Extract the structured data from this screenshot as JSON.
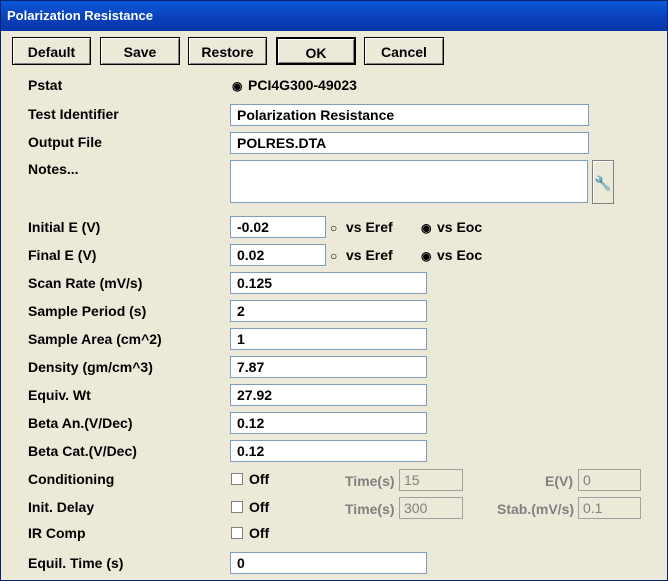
{
  "window": {
    "title": "Polarization Resistance"
  },
  "toolbar": {
    "default_label": "Default",
    "save_label": "Save",
    "restore_label": "Restore",
    "ok_label": "OK",
    "cancel_label": "Cancel"
  },
  "fields": {
    "pstat_label": "Pstat",
    "pstat_value": "PCI4G300-49023",
    "test_identifier_label": "Test Identifier",
    "test_identifier_value": "Polarization Resistance",
    "output_file_label": "Output File",
    "output_file_value": "POLRES.DTA",
    "notes_label": "Notes...",
    "notes_value": "",
    "initial_e_label": "Initial E (V)",
    "initial_e_value": "-0.02",
    "final_e_label": "Final E (V)",
    "final_e_value": "0.02",
    "vs_eref_label": "vs Eref",
    "vs_eoc_label": "vs Eoc",
    "scan_rate_label": "Scan Rate (mV/s)",
    "scan_rate_value": "0.125",
    "sample_period_label": "Sample Period (s)",
    "sample_period_value": "2",
    "sample_area_label": "Sample Area (cm^2)",
    "sample_area_value": "1",
    "density_label": "Density (gm/cm^3)",
    "density_value": "7.87",
    "equiv_wt_label": "Equiv. Wt",
    "equiv_wt_value": "27.92",
    "beta_an_label": "Beta An.(V/Dec)",
    "beta_an_value": "0.12",
    "beta_cat_label": "Beta Cat.(V/Dec)",
    "beta_cat_value": "0.12",
    "conditioning_label": "Conditioning",
    "conditioning_off": "Off",
    "conditioning_time_label": "Time(s)",
    "conditioning_time_value": "15",
    "conditioning_e_label": "E(V)",
    "conditioning_e_value": "0",
    "init_delay_label": "Init. Delay",
    "init_delay_off": "Off",
    "init_delay_time_label": "Time(s)",
    "init_delay_time_value": "300",
    "stab_label": "Stab.(mV/s)",
    "stab_value": "0.1",
    "ir_comp_label": "IR Comp",
    "ir_comp_off": "Off",
    "equil_time_label": "Equil. Time (s)",
    "equil_time_value": "0"
  }
}
